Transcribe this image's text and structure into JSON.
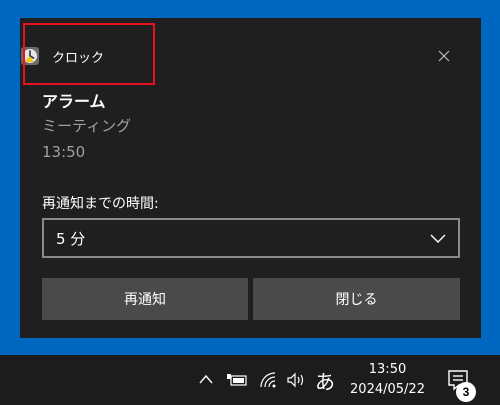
{
  "toast": {
    "app_name": "クロック",
    "title": "アラーム",
    "subtitle": "ミーティング",
    "time": "13:50",
    "snooze_label": "再通知までの時間:",
    "snooze_selected": "5 分",
    "snooze_button": "再通知",
    "dismiss_button": "閉じる",
    "highlight_color": "#e81123"
  },
  "taskbar": {
    "ime": "あ",
    "clock_time": "13:50",
    "clock_date": "2024/05/22",
    "notification_count": "3"
  },
  "icons": {
    "app": "clock-icon",
    "close": "close-icon",
    "dropdown": "chevron-down-icon",
    "tray_expand": "chevron-up-icon",
    "battery": "battery-icon",
    "network": "wifi-icon",
    "volume": "volume-icon",
    "action_center": "action-center-icon"
  },
  "colors": {
    "desktop": "#0067c0",
    "toast_bg": "#1f1f1f",
    "button_bg": "#4a4a4a",
    "taskbar_bg": "#1c1c1c"
  }
}
